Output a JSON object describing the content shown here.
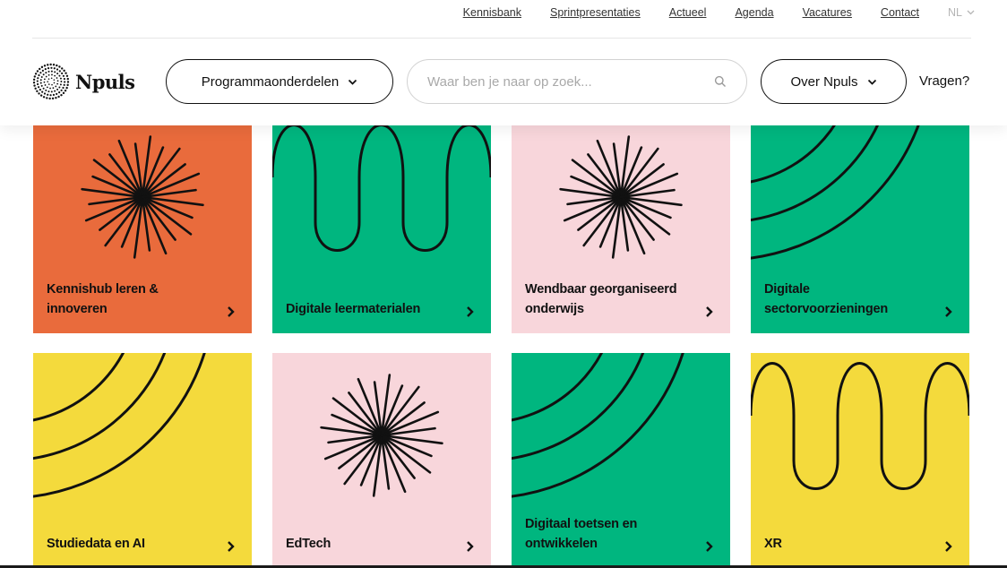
{
  "utility_nav": {
    "items": [
      "Kennisbank",
      "Sprintpresentaties",
      "Actueel",
      "Agenda",
      "Vacatures",
      "Contact"
    ],
    "language": "NL"
  },
  "brand": {
    "name": "Npuls"
  },
  "header": {
    "programs_label": "Programmaonderdelen",
    "search_placeholder": "Waar ben je naar op zoek...",
    "over_label": "Over Npuls",
    "vragen_label": "Vragen?"
  },
  "tiles": [
    {
      "label": "Kennishub leren & innoveren",
      "bg": "#E96B3C",
      "art": "starburst"
    },
    {
      "label": "Digitale leermaterialen",
      "bg": "#00B67F",
      "art": "wave"
    },
    {
      "label": "Wendbaar georganiseerd onderwijs",
      "bg": "#F8D6DB",
      "art": "starburst"
    },
    {
      "label": "Digitale sectorvoorzieningen",
      "bg": "#00B67F",
      "art": "arcs"
    },
    {
      "label": "Studiedata en AI",
      "bg": "#F4DA3C",
      "art": "arcs"
    },
    {
      "label": "EdTech",
      "bg": "#F8D6DB",
      "art": "starburst"
    },
    {
      "label": "Digitaal toetsen en ontwikkelen",
      "bg": "#00B67F",
      "art": "arcs"
    },
    {
      "label": "XR",
      "bg": "#F4DA3C",
      "art": "wave"
    }
  ]
}
